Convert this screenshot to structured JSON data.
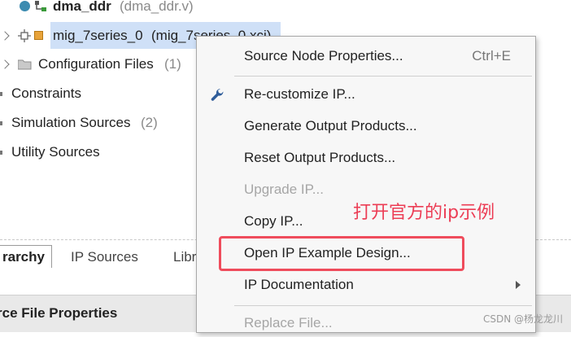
{
  "tree": {
    "top_module": {
      "name": "dma_ddr",
      "file": "(dma_ddr.v)"
    },
    "ip_item": {
      "name": "mig_7series_0",
      "file": "(mig_7series_0.xci)"
    },
    "config_files": {
      "label": "Configuration Files",
      "count": "(1)"
    },
    "constraints": {
      "label": "Constraints"
    },
    "simulation_sources": {
      "label": "Simulation Sources",
      "count": "(2)"
    },
    "utility_sources": {
      "label": "Utility Sources"
    }
  },
  "tabs": {
    "hierarchy": "rarchy",
    "ip_sources": "IP Sources",
    "libraries": "Libr"
  },
  "panel": {
    "title": "rce File Properties"
  },
  "menu": {
    "source_node_properties": {
      "label": "Source Node Properties...",
      "shortcut": "Ctrl+E"
    },
    "recustomize_ip": "Re-customize IP...",
    "generate_output_products": "Generate Output Products...",
    "reset_output_products": "Reset Output Products...",
    "upgrade_ip": "Upgrade IP...",
    "copy_ip": "Copy IP...",
    "open_ip_example_design": "Open IP Example Design...",
    "ip_documentation": "IP Documentation",
    "replace_file": "Replace File..."
  },
  "annotation": {
    "text": "打开官方的ip示例",
    "color": "#ec3d55"
  },
  "watermark": "CSDN @杨龙龙川",
  "colors": {
    "selection": "#cfe0f7",
    "highlight": "#ef4c5c",
    "wrench": "#2f5d9a"
  }
}
